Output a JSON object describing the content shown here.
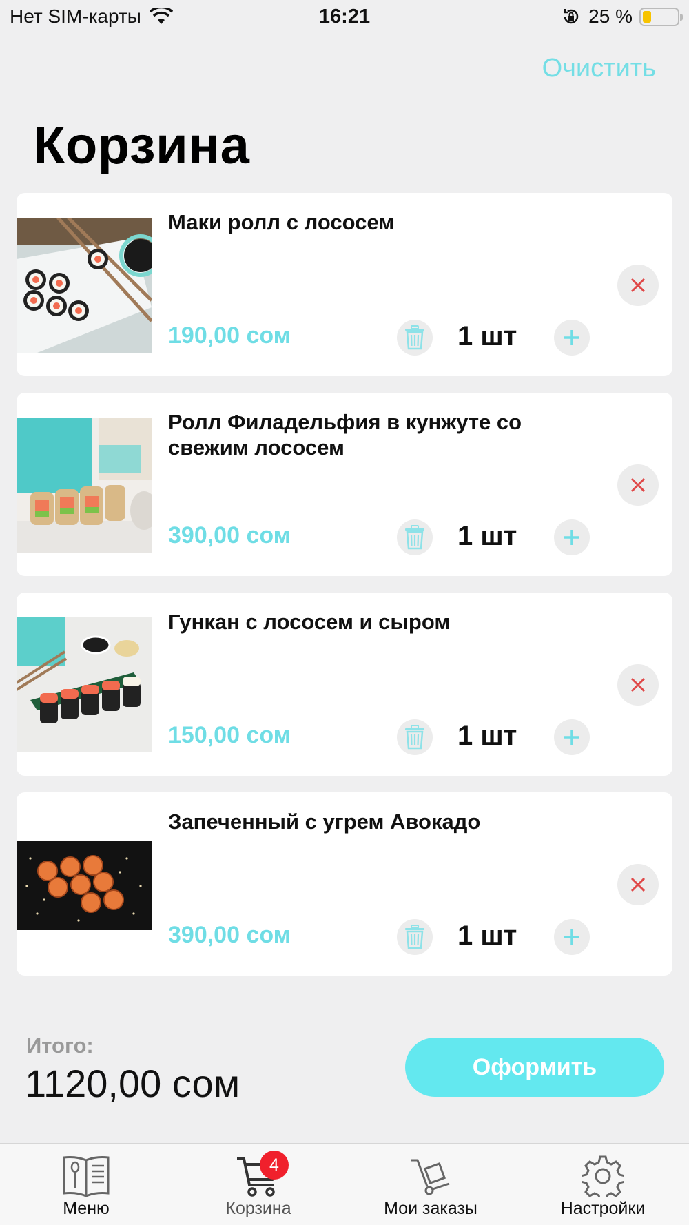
{
  "status_bar": {
    "carrier": "Нет SIM-карты",
    "time": "16:21",
    "battery": "25 %",
    "battery_level": 0.25
  },
  "header": {
    "clear_label": "Очистить",
    "title": "Корзина"
  },
  "cart": {
    "items": [
      {
        "name": "Маки ролл с лососем",
        "price": "190,00 сом",
        "qty": "1 шт"
      },
      {
        "name": "Ролл Филадельфия в кунжуте со свежим лососем",
        "price": "390,00 сом",
        "qty": "1 шт"
      },
      {
        "name": "Гункан с лососем и сыром",
        "price": "150,00 сом",
        "qty": "1 шт"
      },
      {
        "name": "Запеченный с угрем Авокадо",
        "price": "390,00 сом",
        "qty": "1 шт"
      }
    ]
  },
  "summary": {
    "total_label": "Итого:",
    "total_value": "1120,00 сом",
    "checkout_label": "Оформить"
  },
  "tab_bar": {
    "tabs": [
      {
        "label": "Меню",
        "icon": "menu-book-icon"
      },
      {
        "label": "Корзина",
        "icon": "cart-icon",
        "badge": "4"
      },
      {
        "label": "Мои заказы",
        "icon": "hand-truck-icon"
      },
      {
        "label": "Настройки",
        "icon": "gear-icon"
      }
    ]
  },
  "colors": {
    "accent": "#63e8ef",
    "price": "#6fdde5",
    "remove": "#e04848",
    "badge": "#f0202c",
    "background": "#efeff0"
  }
}
